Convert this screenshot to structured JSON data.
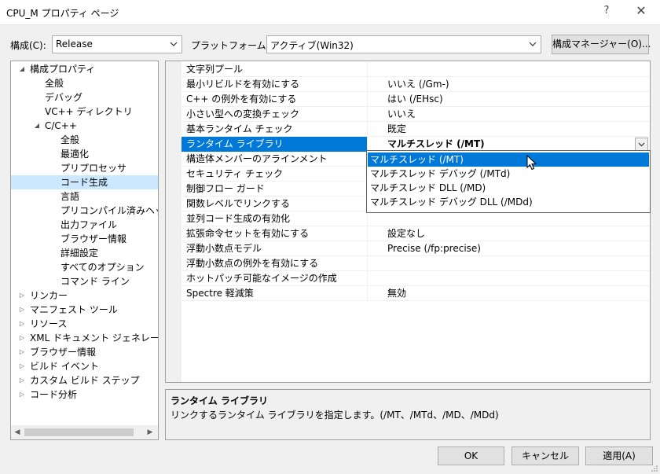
{
  "window": {
    "title": "CPU_M プロパティ ページ",
    "help_label": "?",
    "close_label": "✕"
  },
  "config_row": {
    "config_label": "構成(C):",
    "config_value": "Release",
    "platform_label": "プラットフォーム(P):",
    "platform_value": "アクティブ(Win32)",
    "manager_button": "構成マネージャー(O)..."
  },
  "tree": {
    "items": [
      {
        "label": "構成プロパティ",
        "twisty": "◢"
      },
      {
        "label": "全般"
      },
      {
        "label": "デバッグ"
      },
      {
        "label": "VC++ ディレクトリ"
      },
      {
        "label": "C/C++",
        "twisty": "◢"
      },
      {
        "label": "全般"
      },
      {
        "label": "最適化"
      },
      {
        "label": "プリプロセッサ"
      },
      {
        "label": "コード生成"
      },
      {
        "label": "言語"
      },
      {
        "label": "プリコンパイル済みヘッダー"
      },
      {
        "label": "出力ファイル"
      },
      {
        "label": "ブラウザー情報"
      },
      {
        "label": "詳細設定"
      },
      {
        "label": "すべてのオプション"
      },
      {
        "label": "コマンド ライン"
      },
      {
        "label": "リンカー",
        "twisty": "▷"
      },
      {
        "label": "マニフェスト ツール",
        "twisty": "▷"
      },
      {
        "label": "リソース",
        "twisty": "▷"
      },
      {
        "label": "XML ドキュメント ジェネレーター",
        "twisty": "▷"
      },
      {
        "label": "ブラウザー情報",
        "twisty": "▷"
      },
      {
        "label": "ビルド イベント",
        "twisty": "▷"
      },
      {
        "label": "カスタム ビルド ステップ",
        "twisty": "▷"
      },
      {
        "label": "コード分析",
        "twisty": "▷"
      }
    ],
    "scroll_left": "◀",
    "scroll_right": "▶"
  },
  "grid": {
    "rows": [
      {
        "name": "文字列プール",
        "value": ""
      },
      {
        "name": "最小リビルドを有効にする",
        "value": "いいえ (/Gm-)"
      },
      {
        "name": "C++ の例外を有効にする",
        "value": "はい (/EHsc)"
      },
      {
        "name": "小さい型への変換チェック",
        "value": "いいえ"
      },
      {
        "name": "基本ランタイム チェック",
        "value": "既定"
      },
      {
        "name": "ランタイム ライブラリ",
        "value": "マルチスレッド (/MT)"
      },
      {
        "name": "構造体メンバーのアラインメント",
        "value": ""
      },
      {
        "name": "セキュリティ チェック",
        "value": ""
      },
      {
        "name": "制御フロー ガード",
        "value": ""
      },
      {
        "name": "関数レベルでリンクする",
        "value": ""
      },
      {
        "name": "並列コード生成の有効化",
        "value": ""
      },
      {
        "name": "拡張命令セットを有効にする",
        "value": "設定なし"
      },
      {
        "name": "浮動小数点モデル",
        "value": "Precise (/fp:precise)"
      },
      {
        "name": "浮動小数点の例外を有効にする",
        "value": ""
      },
      {
        "name": "ホットパッチ可能なイメージの作成",
        "value": ""
      },
      {
        "name": "Spectre 軽減策",
        "value": "無効"
      }
    ]
  },
  "dropdown": {
    "options": [
      "マルチスレッド (/MT)",
      "マルチスレッド デバッグ (/MTd)",
      "マルチスレッド DLL (/MD)",
      "マルチスレッド デバッグ DLL (/MDd)"
    ]
  },
  "description": {
    "title": "ランタイム ライブラリ",
    "text": "リンクするランタイム ライブラリを指定します。(/MT、/MTd、/MD、/MDd)"
  },
  "buttons": {
    "ok": "OK",
    "cancel": "キャンセル",
    "apply": "適用(A)"
  },
  "colors": {
    "selection": "#0078d7",
    "tree_selection": "#cce8ff",
    "dialog_bg": "#f0f0f0"
  }
}
